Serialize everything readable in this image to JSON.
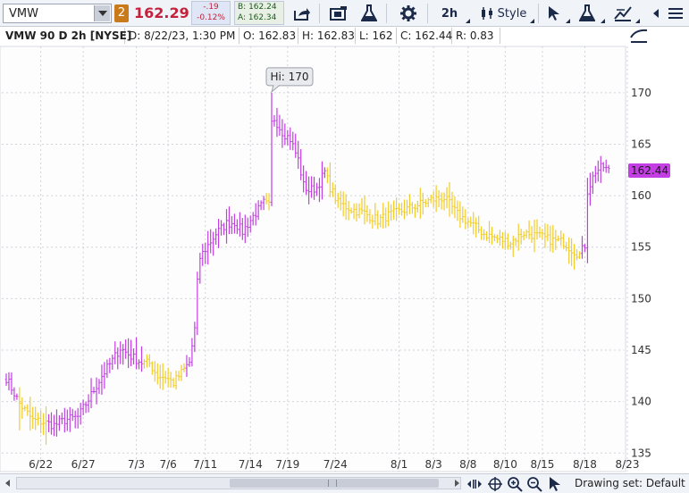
{
  "toolbar": {
    "symbol": "VMW",
    "link_badge": "2",
    "last_price": "162.29",
    "net_change": "-.19",
    "pct_change": "-0.12%",
    "bid": "B: 162.24",
    "ask": "A: 162.34",
    "timeframe": "2h",
    "style_label": "Style"
  },
  "info_bar": {
    "title": "VMW 90 D 2h [NYSE]",
    "date": "D: 8/22/23, 1:30 PM",
    "open": "O: 162.83",
    "high": "H: 162.83",
    "low": "L: 162",
    "close": "C: 162.44",
    "range": "R: 0.83"
  },
  "bottom_bar": {
    "drawing_set": "Drawing set: Default"
  },
  "colors": {
    "up": "#c33fe3",
    "down": "#f2cc2c",
    "price_bubble": "#c33fe3",
    "grid": "#cfd3da"
  },
  "chart_data": {
    "type": "bar",
    "ylim": [
      133.2,
      174.5
    ],
    "y_ticks": [
      135,
      140,
      145,
      150,
      155,
      160,
      165,
      170
    ],
    "x_tick_labels": [
      "6/22",
      "6/27",
      "7/3",
      "7/6",
      "7/11",
      "7/14",
      "7/19",
      "7/24",
      "8/1",
      "8/3",
      "8/8",
      "8/10",
      "8/15",
      "8/18",
      "8/23"
    ],
    "high_label": "Hi: 170",
    "last_label": "162.44",
    "last_value": 162.44,
    "anchors": [
      [
        0,
        142.3
      ],
      [
        5,
        139.8
      ],
      [
        10,
        138.2
      ],
      [
        14,
        138.0
      ],
      [
        18,
        137.7
      ],
      [
        22,
        138.2
      ],
      [
        27,
        138.5
      ],
      [
        31,
        140.2
      ],
      [
        36,
        142.5
      ],
      [
        40,
        144.0
      ],
      [
        43,
        145.2
      ],
      [
        47,
        144.4
      ],
      [
        51,
        143.8
      ],
      [
        54,
        143.7
      ],
      [
        57,
        142.5
      ],
      [
        60,
        142.4
      ],
      [
        63,
        141.8
      ],
      [
        66,
        142.8
      ],
      [
        69,
        143.8
      ],
      [
        71,
        147.0
      ],
      [
        72,
        151.5
      ],
      [
        73,
        154.0
      ],
      [
        75,
        154.8
      ],
      [
        79,
        156.3
      ],
      [
        83,
        157.3
      ],
      [
        86,
        157.4
      ],
      [
        89,
        156.5
      ],
      [
        93,
        158.0
      ],
      [
        97,
        159.3
      ],
      [
        99,
        159.0
      ],
      [
        100,
        167.0
      ],
      [
        101,
        167.5
      ],
      [
        104,
        166.2
      ],
      [
        107,
        165.5
      ],
      [
        110,
        163.5
      ],
      [
        112,
        161.0
      ],
      [
        114,
        160.5
      ],
      [
        117,
        160.8
      ],
      [
        120,
        162.3
      ],
      [
        122,
        160.8
      ],
      [
        125,
        159.3
      ],
      [
        130,
        158.7
      ],
      [
        135,
        158.3
      ],
      [
        140,
        157.6
      ],
      [
        145,
        158.2
      ],
      [
        150,
        158.6
      ],
      [
        155,
        159.1
      ],
      [
        160,
        159.6
      ],
      [
        165,
        159.8
      ],
      [
        170,
        158.2
      ],
      [
        175,
        157.3
      ],
      [
        180,
        156.3
      ],
      [
        185,
        155.8
      ],
      [
        190,
        155.5
      ],
      [
        195,
        156.4
      ],
      [
        200,
        156.1
      ],
      [
        205,
        155.7
      ],
      [
        210,
        155.5
      ],
      [
        213,
        154.8
      ],
      [
        216,
        154.3
      ],
      [
        218,
        155.2
      ],
      [
        219,
        160.5
      ],
      [
        222,
        162.4
      ],
      [
        225,
        162.8
      ],
      [
        227,
        162.4
      ]
    ],
    "color_runs": [
      [
        0,
        4,
        "up"
      ],
      [
        5,
        15,
        "down"
      ],
      [
        16,
        51,
        "up"
      ],
      [
        52,
        67,
        "down"
      ],
      [
        68,
        97,
        "up"
      ],
      [
        98,
        99,
        "down"
      ],
      [
        100,
        120,
        "up"
      ],
      [
        121,
        216,
        "down"
      ],
      [
        217,
        227,
        "up"
      ]
    ]
  }
}
